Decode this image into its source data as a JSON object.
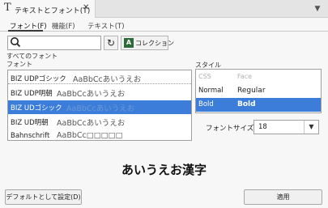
{
  "tab": {
    "icon": "text-t-icon",
    "label": "テキストとフォント(T)",
    "close_icon": "close-icon"
  },
  "window": {
    "collapse_icon": "chevron-down-icon"
  },
  "subtabs": [
    {
      "label": "フォント(F)",
      "active": true
    },
    {
      "label": "機能(F)",
      "active": false
    },
    {
      "label": "テキスト(T)",
      "active": false
    }
  ],
  "search": {
    "value": "",
    "placeholder": "",
    "icon": "search-icon"
  },
  "refresh": {
    "icon": "refresh-icon",
    "glyph": "↻"
  },
  "collection": {
    "icon": "collection-icon",
    "glyph": "A",
    "label": "コレクション"
  },
  "all_fonts_label": "すべてのフォント",
  "font_section_label": "フォント",
  "fonts": [
    {
      "name": "BIZ UDPゴシック",
      "sample": "AaBbCcあいうえお",
      "selected": false
    },
    {
      "name": "BIZ UDP明朝",
      "sample": "AaBbCcあいうえお",
      "selected": false
    },
    {
      "name": "BIZ UDゴシック",
      "sample": "AaBbCcあいうえお",
      "selected": true
    },
    {
      "name": "BIZ UD明朝",
      "sample": "AaBbCcあいうえお",
      "selected": false
    },
    {
      "name": "Bahnschrift",
      "sample": "AaBbCc□□□□□",
      "selected": false
    }
  ],
  "style_section_label": "スタイル",
  "style_columns": {
    "css": "CSS",
    "face": "Face"
  },
  "styles": [
    {
      "css": "Normal",
      "face": "Regular",
      "selected": false
    },
    {
      "css": "Bold",
      "face": "Bold",
      "selected": true
    }
  ],
  "font_size": {
    "label": "フォントサイズ",
    "value": "18",
    "arrow_icon": "dropdown-arrow-icon"
  },
  "preview_text": "あいうえお漢字",
  "buttons": {
    "default": "デフォルトとして設定(D)",
    "apply": "適用"
  }
}
